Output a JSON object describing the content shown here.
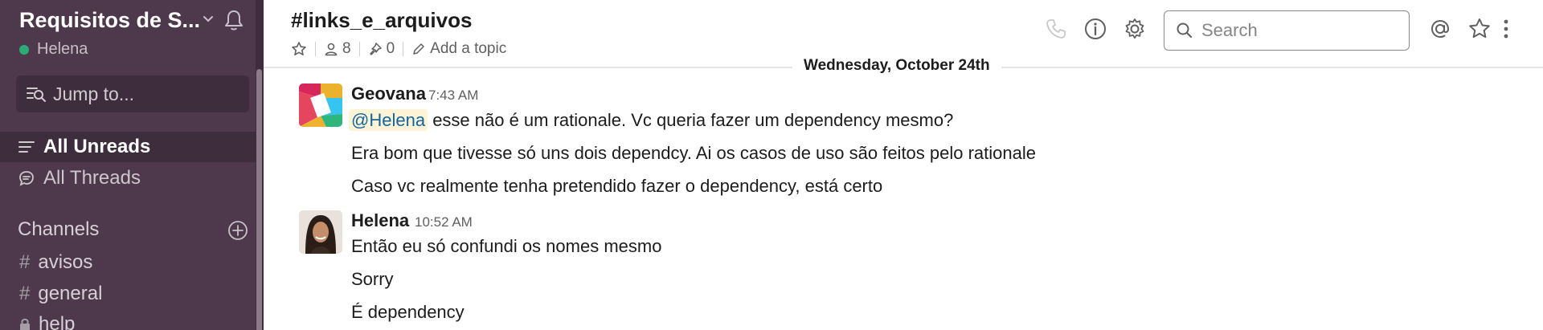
{
  "sidebar": {
    "team_name": "Requisitos de S...",
    "user_name": "Helena",
    "jump_to": "Jump to...",
    "nav": [
      {
        "label": "All Unreads",
        "icon": "list-icon"
      },
      {
        "label": "All Threads",
        "icon": "threads-icon"
      }
    ],
    "channels_heading": "Channels",
    "channels": [
      {
        "name": "avisos"
      },
      {
        "name": "general"
      },
      {
        "name": "help"
      }
    ]
  },
  "header": {
    "channel_name": "#links_e_arquivos",
    "member_count": "8",
    "pinned_count": "0",
    "add_topic": "Add a topic",
    "search_placeholder": "Search"
  },
  "conversation": {
    "date_divider": "Wednesday, October 24th",
    "messages": [
      {
        "sender": "Geovana",
        "time": "7:43 AM",
        "mention": "@Helena",
        "lines": [
          "esse não é um rationale. Vc queria fazer um dependency mesmo?",
          "Era bom que tivesse só uns dois dependcy. Ai os casos de uso são feitos pelo rationale",
          "Caso vc realmente tenha pretendido fazer o dependency, está certo"
        ]
      },
      {
        "sender": "Helena",
        "time": "10:52 AM",
        "lines": [
          "Então eu só confundi os nomes mesmo",
          "Sorry",
          "É dependency"
        ]
      }
    ]
  },
  "colors": {
    "sidebar_bg": "#4d394b",
    "presence_online": "#2bac76",
    "mention_bg": "#fcf4d5",
    "mention_text": "#1264a3"
  }
}
